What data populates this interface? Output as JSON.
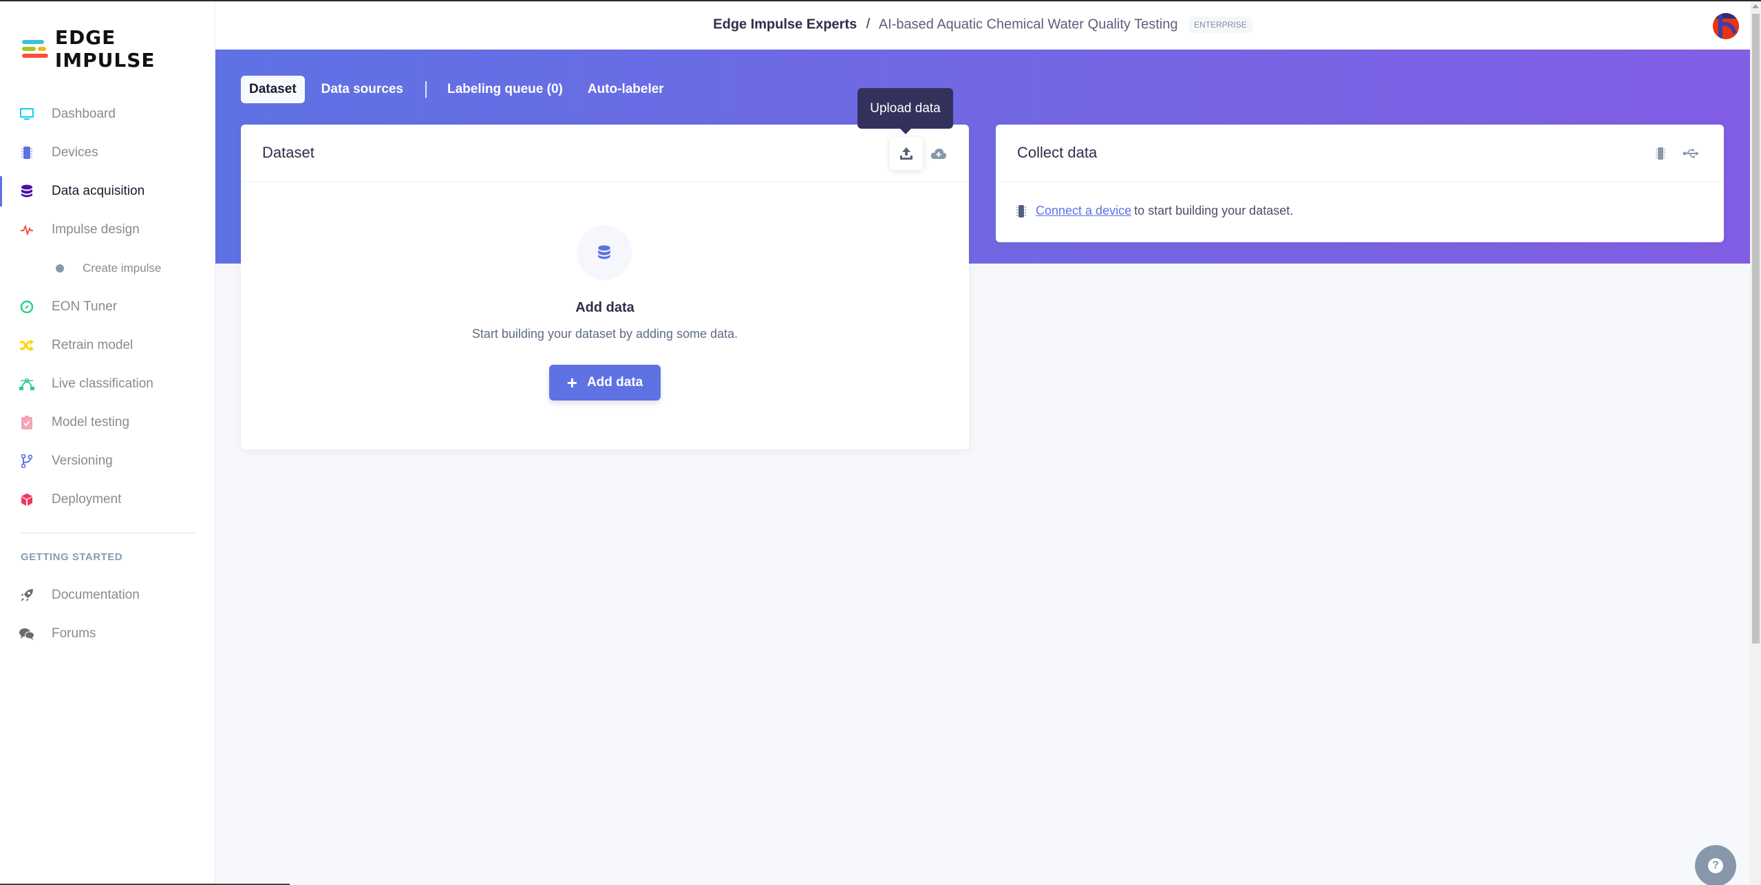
{
  "brand": {
    "name": "EDGE IMPULSE"
  },
  "sidebar": {
    "items": [
      {
        "label": "Dashboard",
        "icon": "monitor-icon",
        "color": "#11cdef"
      },
      {
        "label": "Devices",
        "icon": "chip-icon",
        "color": "#5e72e4"
      },
      {
        "label": "Data acquisition",
        "icon": "database-icon",
        "color": "#4c0fa8",
        "active": true
      },
      {
        "label": "Impulse design",
        "icon": "pulse-icon",
        "color": "#f5533d"
      },
      {
        "label": "Create impulse",
        "icon": "dot-icon",
        "color": "#8898aa",
        "sub": true
      },
      {
        "label": "EON Tuner",
        "icon": "compass-icon",
        "color": "#2dce89"
      },
      {
        "label": "Retrain model",
        "icon": "shuffle-icon",
        "color": "#ffd600"
      },
      {
        "label": "Live classification",
        "icon": "bezier-icon",
        "color": "#2dce89"
      },
      {
        "label": "Model testing",
        "icon": "clipboard-check-icon",
        "color": "#f3a4b5"
      },
      {
        "label": "Versioning",
        "icon": "branch-icon",
        "color": "#5e72e4"
      },
      {
        "label": "Deployment",
        "icon": "cube-icon",
        "color": "#f5365c"
      }
    ],
    "section_label": "GETTING STARTED",
    "footer_items": [
      {
        "label": "Documentation",
        "icon": "rocket-icon"
      },
      {
        "label": "Forums",
        "icon": "comments-icon"
      }
    ]
  },
  "header": {
    "organization": "Edge Impulse Experts",
    "separator": "/",
    "project": "AI-based Aquatic Chemical Water Quality Testing",
    "badge": "ENTERPRISE"
  },
  "tabs": [
    {
      "label": "Dataset",
      "active": true
    },
    {
      "label": "Data sources"
    },
    {
      "label": "Labeling queue (0)"
    },
    {
      "label": "Auto-labeler"
    }
  ],
  "dataset_card": {
    "title": "Dataset",
    "tooltip": "Upload data",
    "empty_title": "Add data",
    "empty_subtitle": "Start building your dataset by adding some data.",
    "add_button": "Add data"
  },
  "collect_card": {
    "title": "Collect data",
    "link": "Connect a device",
    "text": "to start building your dataset."
  },
  "help": {
    "label": "?"
  },
  "colors": {
    "accent": "#5e72e4",
    "band_start": "#5e72e4",
    "band_end": "#825ee4",
    "tooltip": "#32325d"
  }
}
